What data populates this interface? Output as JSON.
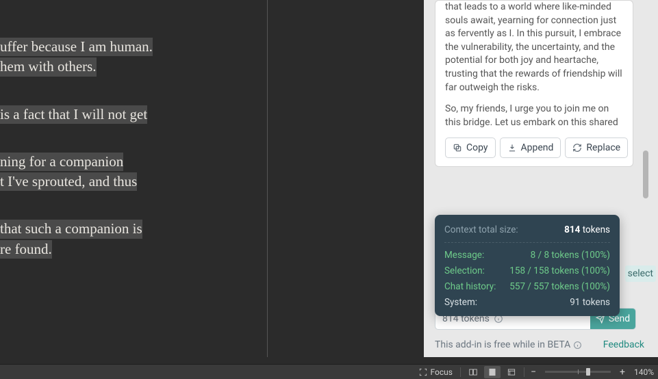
{
  "doc": {
    "p1l1": "uffer because I am human.",
    "p1l2": "hem with others.",
    "p2l1": " is a fact that I will not get",
    "p3l1": "ning for a companion",
    "p3l2": "t I've sprouted, and thus",
    "p4l1": "that such a companion is",
    "p4l2": "re found."
  },
  "ai": {
    "para1": "that leads to a world where like-minded souls await, yearning for connection just as fervently as I. In this pursuit, I embrace the vulnerability, the uncertainty, and the potential for both joy and heartache, trusting that the rewards of friendship will far outweigh the risks.",
    "para2": "So, my friends, I urge you to join me on this bridge. Let us embark on this shared",
    "copy": "Copy",
    "append": "Append",
    "replace": "Replace"
  },
  "ctx": {
    "head_label": "Context total size:",
    "head_val_num": "814",
    "head_val_unit": " tokens",
    "msg_label": "Message:",
    "msg_val": "8 / 8 tokens (100%)",
    "sel_label": "Selection:",
    "sel_val": "158 / 158 tokens (100%)",
    "chat_label": "Chat history:",
    "chat_val": "557 / 557 tokens (100%)",
    "sys_label": "System:",
    "sys_val": "91 tokens"
  },
  "peek": "select",
  "token_row": "814 tokens",
  "send": "Send",
  "footer": {
    "beta": "This add-in is free while in BETA",
    "feedback": "Feedback"
  },
  "status": {
    "focus": "Focus",
    "zoom": "140%"
  }
}
